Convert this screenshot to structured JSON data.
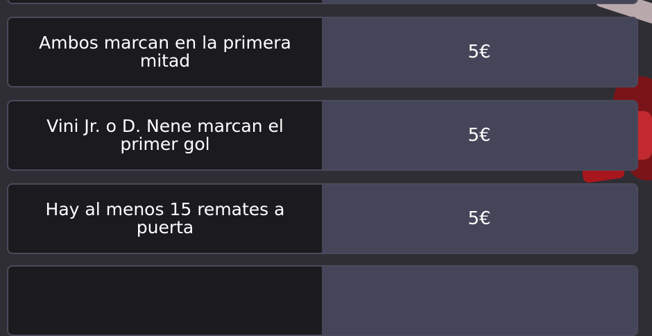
{
  "bets": [
    {
      "label": "",
      "stake": ""
    },
    {
      "label": "Ambos marcan en la primera mitad",
      "stake": "5€"
    },
    {
      "label": "Vini Jr. o D. Nene marcan el primer gol",
      "stake": "5€"
    },
    {
      "label": "Hay al menos 15 remates a puerta",
      "stake": "5€"
    },
    {
      "label": "",
      "stake": ""
    }
  ],
  "theme": {
    "page_background": "#2f2e35",
    "label_background": "#1b1a1e",
    "value_background": "#454559",
    "border": "#4b4a5c",
    "text": "#ffffff"
  }
}
